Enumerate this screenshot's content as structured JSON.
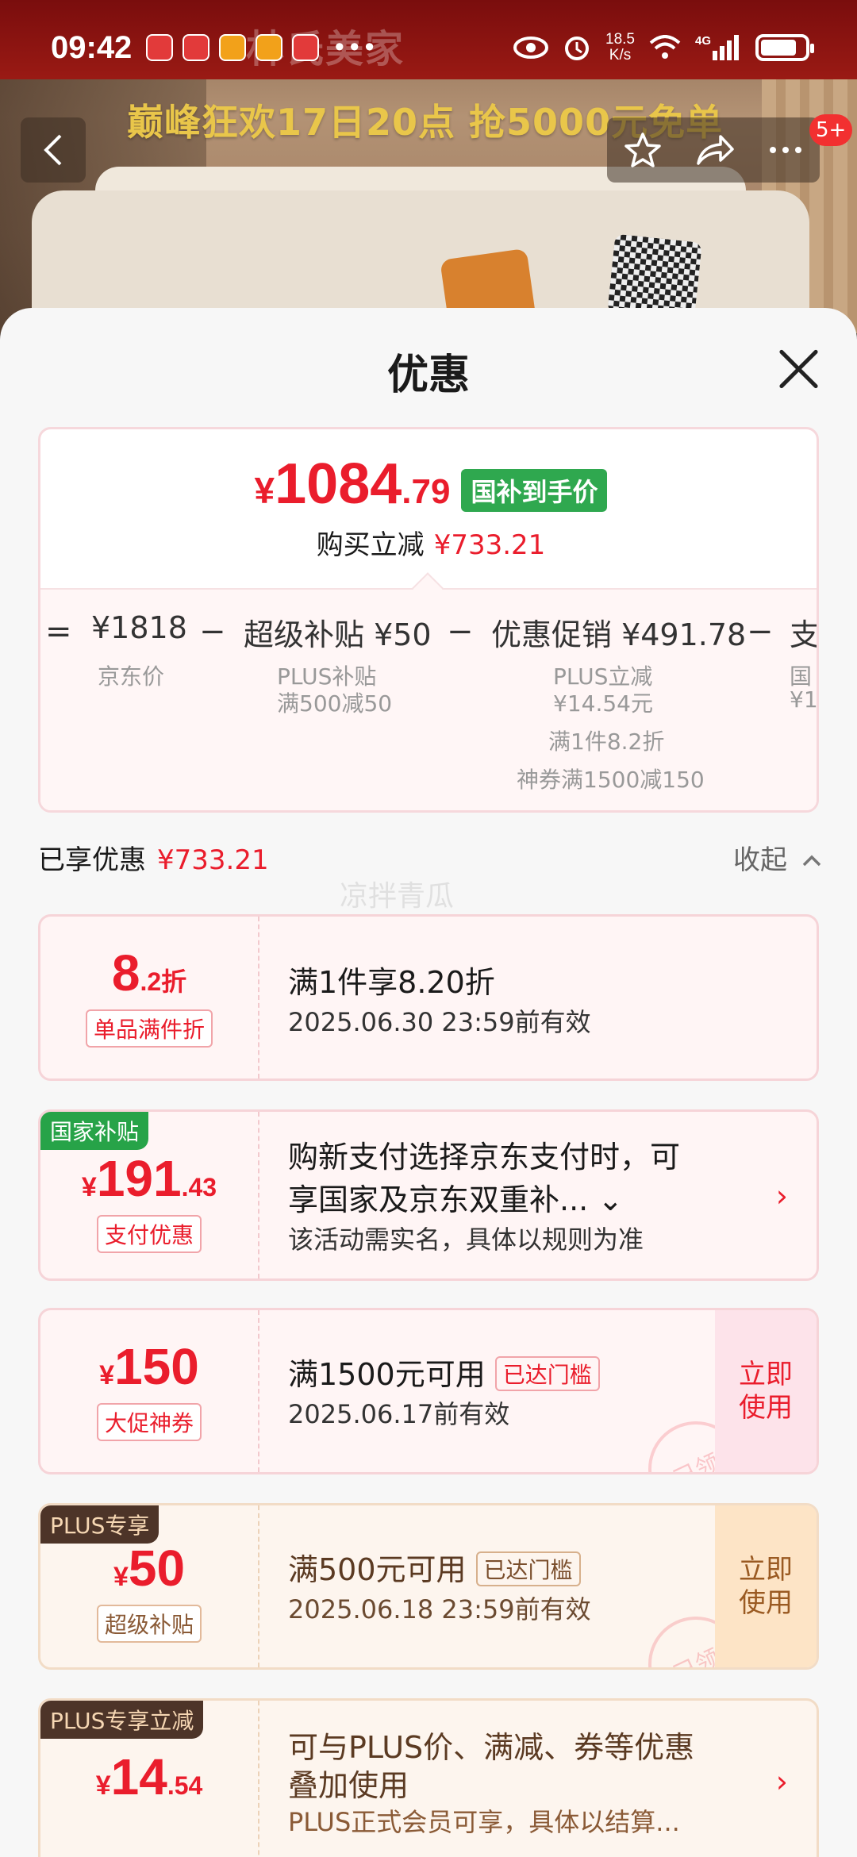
{
  "status_bar": {
    "time": "09:42",
    "net_speed_top": "18.5",
    "net_speed_unit": "K/s",
    "network": "4G"
  },
  "hero": {
    "brand_watermark": "林氏美家",
    "promo_banner": "巅峰狂欢17日20点 抢5000元免单",
    "cart_badge": "5+"
  },
  "icons": {
    "back": "chevron-left-icon",
    "favorite": "star-icon",
    "share": "share-icon",
    "more": "more-icon",
    "close": "close-icon"
  },
  "sheet": {
    "title": "优惠"
  },
  "summary": {
    "price_yen": "¥",
    "price_int": "1084",
    "price_dec": ".79",
    "price_tag": "国补到手价",
    "reduce_label": "购买立减",
    "reduce_amount": "¥733.21",
    "breakdown": [
      {
        "op": "=",
        "main": "¥1818",
        "subs": [
          "京东价"
        ]
      },
      {
        "op": "−",
        "main": "超级补贴 ¥50",
        "subs": [
          "PLUS补贴",
          "满500减50"
        ]
      },
      {
        "op": "−",
        "main": "优惠促销 ¥491.78",
        "subs": [
          "PLUS立减",
          "¥14.54元",
          "满1件8.2折",
          "神券满1500减150"
        ]
      },
      {
        "op": "−",
        "main": "支",
        "subs": [
          "国",
          "¥1"
        ]
      }
    ]
  },
  "enjoyed": {
    "label": "已享优惠",
    "amount": "¥733.21",
    "collapse_label": "收起",
    "watermark": "凉拌青瓜"
  },
  "coupons": [
    {
      "value_big": "8",
      "value_small": ".2折",
      "chip": "单品满件折",
      "title": "满1件享8.20折",
      "sub": "2025.06.30 23:59前有效"
    },
    {
      "corner": "国家补贴",
      "yen": "¥",
      "value_big": "191",
      "value_small": ".43",
      "chip": "支付优惠",
      "title_line1": "购新支付选择京东支付时，可",
      "title_line2": "享国家及京东双重补... ⌄",
      "sub": "该活动需实名，具体以规则为准"
    },
    {
      "yen": "¥",
      "value_big": "150",
      "chip": "大促神券",
      "title": "满1500元可用",
      "threshold": "已达门槛",
      "sub": "2025.06.17前有效",
      "use_label": "立即使用",
      "stamp": "已领"
    },
    {
      "corner": "PLUS专享",
      "yen": "¥",
      "value_big": "50",
      "chip": "超级补贴",
      "title": "满500元可用",
      "threshold": "已达门槛",
      "sub": "2025.06.18 23:59前有效",
      "use_label": "立即使用",
      "stamp": "已领"
    },
    {
      "corner": "PLUS专享立减",
      "yen": "¥",
      "value_big": "14",
      "value_small": ".54",
      "title_line1": "可与PLUS价、满减、券等优惠",
      "title_line2": "叠加使用",
      "sub": "PLUS正式会员可享，具体以结算..."
    }
  ]
}
